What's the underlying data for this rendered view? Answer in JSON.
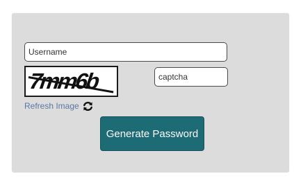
{
  "form": {
    "username": {
      "placeholder": "Username",
      "value": ""
    },
    "captcha_image": {
      "text": "7mm6b"
    },
    "captcha_input": {
      "placeholder": "captcha",
      "value": ""
    },
    "refresh": {
      "label": "Refresh Image",
      "icon": "refresh-icon"
    },
    "generate_button": {
      "label": "Generate Password"
    }
  },
  "colors": {
    "panel_background": "#dcdcdc",
    "button_background": "#1c6b75",
    "link_text": "#5a76a6"
  }
}
